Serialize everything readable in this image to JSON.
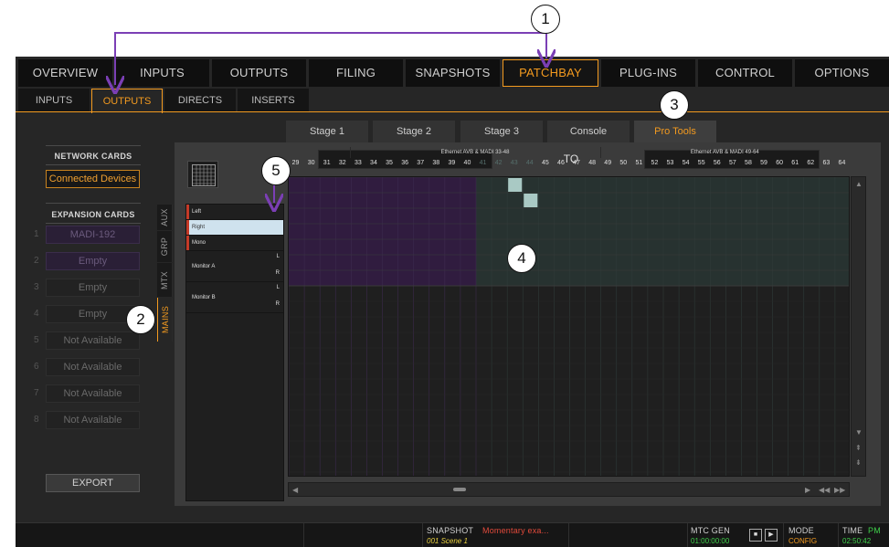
{
  "annotations": [
    "1",
    "2",
    "3",
    "4",
    "5"
  ],
  "colors": {
    "accent": "#f39a1f",
    "callout_arrow": "#7b3fb5",
    "route_purple": "#301c3f",
    "route_teal": "#a9c9c4"
  },
  "main_nav": [
    "OVERVIEW",
    "INPUTS",
    "OUTPUTS",
    "FILING",
    "SNAPSHOTS",
    "PATCHBAY",
    "PLUG-INS",
    "CONTROL",
    "OPTIONS"
  ],
  "main_nav_active": "PATCHBAY",
  "sub_nav": [
    "INPUTS",
    "OUTPUTS",
    "DIRECTS",
    "INSERTS"
  ],
  "sub_nav_active": "OUTPUTS",
  "left_panel": {
    "network_header": "NETWORK CARDS",
    "connected_devices": "Connected Devices",
    "expansion_header": "EXPANSION CARDS",
    "slots": [
      {
        "num": "1",
        "label": "MADI-192"
      },
      {
        "num": "2",
        "label": "Empty"
      },
      {
        "num": "3",
        "label": "Empty"
      },
      {
        "num": "4",
        "label": "Empty"
      },
      {
        "num": "5",
        "label": "Not Available"
      },
      {
        "num": "6",
        "label": "Not Available"
      },
      {
        "num": "7",
        "label": "Not Available"
      },
      {
        "num": "8",
        "label": "Not Available"
      }
    ],
    "export": "EXPORT"
  },
  "side_tabs": [
    "AUX",
    "GRP",
    "MTX",
    "MAINS"
  ],
  "side_tab_active": "MAINS",
  "stage_tabs": [
    "Stage 1",
    "Stage 2",
    "Stage 3",
    "Console",
    "Pro Tools"
  ],
  "stage_tab_active": "Pro Tools",
  "to_label": "TO",
  "column_groups": [
    {
      "label": "",
      "start": 29,
      "end": 32
    },
    {
      "label": "Ethernet AVB & MADI 33-48",
      "start": 33,
      "end": 48
    },
    {
      "label": "Ethernet AVB & MADI 49-64",
      "start": 49,
      "end": 64
    }
  ],
  "columns": [
    "29",
    "30",
    "31",
    "32",
    "33",
    "34",
    "35",
    "36",
    "37",
    "38",
    "39",
    "40",
    "41",
    "42",
    "43",
    "44",
    "45",
    "46",
    "47",
    "48",
    "49",
    "50",
    "51",
    "52",
    "53",
    "54",
    "55",
    "56",
    "57",
    "58",
    "59",
    "60",
    "61",
    "62",
    "63",
    "64"
  ],
  "dim_columns": [
    "41",
    "42",
    "43",
    "44"
  ],
  "rows": {
    "left": "Left",
    "right": "Right",
    "mono": "Mono",
    "monitor_a": "Monitor A",
    "monitor_b": "Monitor B",
    "l": "L",
    "r": "R"
  },
  "patches": [
    {
      "row": "Left",
      "column": "43"
    },
    {
      "row": "Right",
      "column": "44"
    }
  ],
  "status": {
    "snapshot_label": "SNAPSHOT",
    "snapshot_name": "Momentary exa...",
    "snapshot_scene": "001 Scene 1",
    "mtc_label": "MTC GEN",
    "mtc_value": "01:00:00:00",
    "mode_label": "MODE",
    "mode_value": "CONFIG",
    "time_label": "TIME",
    "time_ampm": "PM",
    "time_value": "02:50:42"
  }
}
